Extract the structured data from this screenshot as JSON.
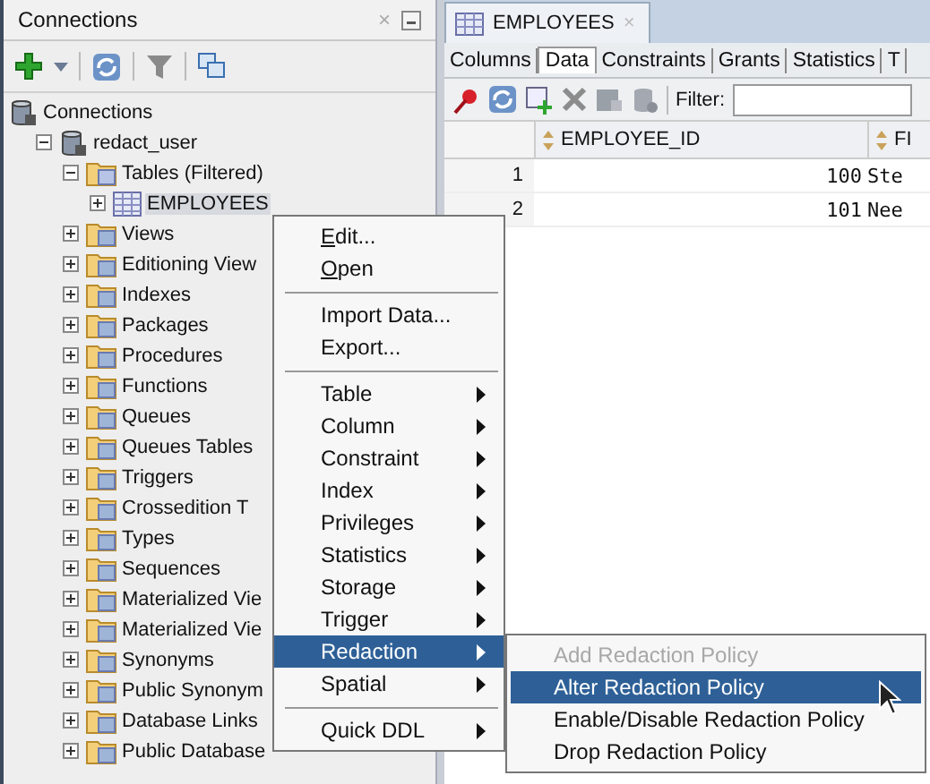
{
  "connections_panel": {
    "title": "Connections",
    "close": "×",
    "tree": [
      {
        "label": "Connections",
        "kind": "connections",
        "selected": false,
        "children": [
          {
            "label": "redact_user",
            "kind": "database",
            "expanded": true,
            "selected": false,
            "children": [
              {
                "label": "Tables (Filtered)",
                "kind": "table-folder",
                "expanded": true,
                "selected": false,
                "children": [
                  {
                    "label": "EMPLOYEES",
                    "kind": "table",
                    "expanded": false,
                    "selected": true
                  }
                ]
              },
              {
                "label": "Views",
                "kind": "folder",
                "expanded": false,
                "selected": false
              },
              {
                "label": "Editioning View",
                "kind": "folder",
                "expanded": false,
                "selected": false
              },
              {
                "label": "Indexes",
                "kind": "folder",
                "expanded": false,
                "selected": false
              },
              {
                "label": "Packages",
                "kind": "folder",
                "expanded": false,
                "selected": false
              },
              {
                "label": "Procedures",
                "kind": "folder",
                "expanded": false,
                "selected": false
              },
              {
                "label": "Functions",
                "kind": "folder",
                "expanded": false,
                "selected": false
              },
              {
                "label": "Queues",
                "kind": "folder",
                "expanded": false,
                "selected": false
              },
              {
                "label": "Queues Tables",
                "kind": "folder",
                "expanded": false,
                "selected": false
              },
              {
                "label": "Triggers",
                "kind": "folder",
                "expanded": false,
                "selected": false
              },
              {
                "label": "Crossedition T",
                "kind": "folder",
                "expanded": false,
                "selected": false
              },
              {
                "label": "Types",
                "kind": "folder",
                "expanded": false,
                "selected": false
              },
              {
                "label": "Sequences",
                "kind": "folder",
                "expanded": false,
                "selected": false
              },
              {
                "label": "Materialized Vie",
                "kind": "folder",
                "expanded": false,
                "selected": false
              },
              {
                "label": "Materialized Vie",
                "kind": "folder",
                "expanded": false,
                "selected": false
              },
              {
                "label": "Synonyms",
                "kind": "folder",
                "expanded": false,
                "selected": false
              },
              {
                "label": "Public Synonym",
                "kind": "folder",
                "expanded": false,
                "selected": false
              },
              {
                "label": "Database Links",
                "kind": "folder",
                "expanded": false,
                "selected": false
              },
              {
                "label": "Public Database",
                "kind": "folder",
                "expanded": false,
                "selected": false
              }
            ]
          }
        ]
      }
    ]
  },
  "editor": {
    "tab": {
      "label": "EMPLOYEES",
      "close": "×"
    },
    "subtabs": [
      {
        "label": "Columns",
        "selected": false
      },
      {
        "label": "Data",
        "selected": true
      },
      {
        "label": "Constraints",
        "selected": false
      },
      {
        "label": "Grants",
        "selected": false
      },
      {
        "label": "Statistics",
        "selected": false
      },
      {
        "label": "T",
        "selected": false
      }
    ],
    "filter_label": "Filter:",
    "columns": [
      "EMPLOYEE_ID",
      "FI"
    ],
    "rows": [
      {
        "number": "1",
        "cells": [
          "100",
          "Ste"
        ]
      },
      {
        "number": "2",
        "cells": [
          "101",
          "Nee"
        ]
      }
    ]
  },
  "context_menu": {
    "items": [
      {
        "kind": "action",
        "label": "Edit...",
        "mnemonic": true,
        "selected": false
      },
      {
        "kind": "action",
        "label": "Open",
        "mnemonic": true,
        "selected": false
      },
      {
        "kind": "separator"
      },
      {
        "kind": "action",
        "label": "Import Data...",
        "mnemonic": false,
        "selected": false
      },
      {
        "kind": "action",
        "label": "Export...",
        "mnemonic": false,
        "selected": false
      },
      {
        "kind": "separator"
      },
      {
        "kind": "submenu",
        "label": "Table",
        "selected": false
      },
      {
        "kind": "submenu",
        "label": "Column",
        "selected": false
      },
      {
        "kind": "submenu",
        "label": "Constraint",
        "selected": false
      },
      {
        "kind": "submenu",
        "label": "Index",
        "selected": false
      },
      {
        "kind": "submenu",
        "label": "Privileges",
        "selected": false
      },
      {
        "kind": "submenu",
        "label": "Statistics",
        "selected": false
      },
      {
        "kind": "submenu",
        "label": "Storage",
        "selected": false
      },
      {
        "kind": "submenu",
        "label": "Trigger",
        "selected": false
      },
      {
        "kind": "submenu",
        "label": "Redaction",
        "selected": true
      },
      {
        "kind": "submenu",
        "label": "Spatial",
        "selected": false
      },
      {
        "kind": "separator"
      },
      {
        "kind": "submenu",
        "label": "Quick DDL",
        "selected": false
      }
    ]
  },
  "submenu": {
    "items": [
      {
        "label": "Add Redaction Policy",
        "disabled": true,
        "selected": false
      },
      {
        "label": "Alter Redaction Policy",
        "disabled": false,
        "selected": true
      },
      {
        "label": "Enable/Disable Redaction Policy",
        "disabled": false,
        "selected": false
      },
      {
        "label": "Drop Redaction Policy",
        "disabled": false,
        "selected": false
      }
    ]
  }
}
